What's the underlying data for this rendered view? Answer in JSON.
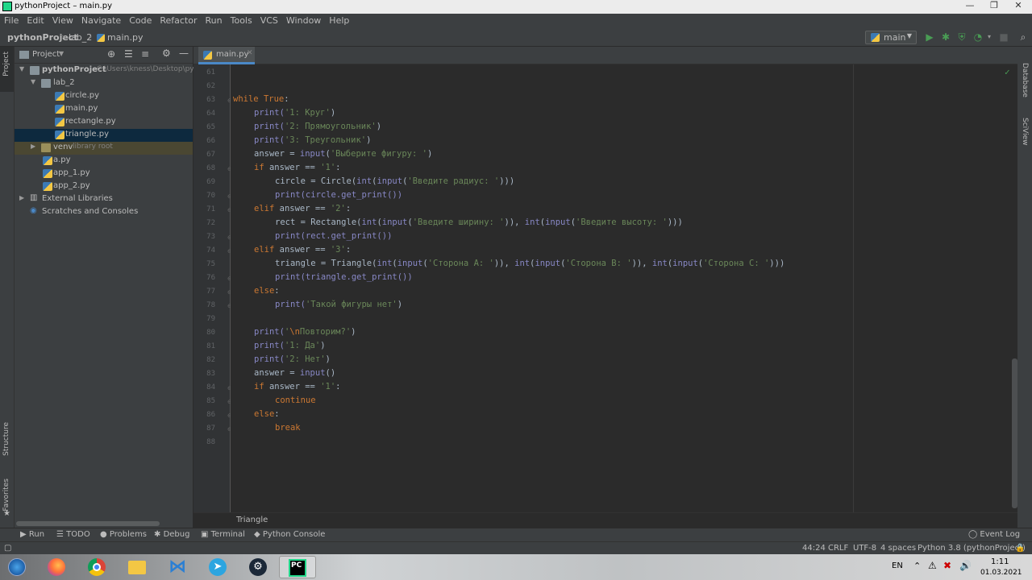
{
  "window": {
    "title": "pythonProject – main.py"
  },
  "menu": [
    "File",
    "Edit",
    "View",
    "Navigate",
    "Code",
    "Refactor",
    "Run",
    "Tools",
    "VCS",
    "Window",
    "Help"
  ],
  "breadcrumbs": [
    "pythonProject",
    "lab_2",
    "main.py"
  ],
  "run_config": "main",
  "left_tools": {
    "project": "Project",
    "structure": "Structure",
    "favorites": "Favorites"
  },
  "right_tools": {
    "database": "Database",
    "sciview": "SciView"
  },
  "project_panel": {
    "title": "Project",
    "root": {
      "name": "pythonProject",
      "path": "C:\\Users\\kness\\Desktop\\pyth"
    },
    "tree": [
      {
        "label": "lab_2"
      },
      {
        "label": "circle.py"
      },
      {
        "label": "main.py"
      },
      {
        "label": "rectangle.py"
      },
      {
        "label": "triangle.py"
      },
      {
        "label": "venv",
        "hint": "library root"
      },
      {
        "label": "a.py"
      },
      {
        "label": "app_1.py"
      },
      {
        "label": "app_2.py"
      },
      {
        "label": "External Libraries"
      },
      {
        "label": "Scratches and Consoles"
      }
    ]
  },
  "editor": {
    "tab": "main.py",
    "line_numbers": [
      "61",
      "62",
      "63",
      "64",
      "65",
      "66",
      "67",
      "68",
      "69",
      "70",
      "71",
      "72",
      "73",
      "74",
      "75",
      "76",
      "77",
      "78",
      "79",
      "80",
      "81",
      "82",
      "83",
      "84",
      "85",
      "86",
      "87",
      "88"
    ],
    "code": {
      "l63a": "while",
      "l63b": "True",
      "l64a": "print(",
      "l64b": "'1: Круг'",
      "l64c": ")",
      "l65a": "print(",
      "l65b": "'2: Прямоугольник'",
      "l65c": ")",
      "l66a": "print(",
      "l66b": "'3: Треугольник'",
      "l66c": ")",
      "l67a": "answer = ",
      "l67b": "input",
      "l67c": "(",
      "l67d": "'Выберите фигуру: '",
      "l67e": ")",
      "l68a": "if",
      "l68b": " answer == ",
      "l68c": "'1'",
      "l68d": ":",
      "l69a": "circle = Circle(",
      "l69b": "int",
      "l69c": "(",
      "l69d": "input",
      "l69e": "(",
      "l69f": "'Введите радиус: '",
      "l69g": ")))",
      "l70": "print(circle.get_print())",
      "l71a": "elif",
      "l71b": " answer == ",
      "l71c": "'2'",
      "l71d": ":",
      "l72a": "rect = Rectangle(",
      "l72b": "int",
      "l72c": "(",
      "l72d": "input",
      "l72e": "(",
      "l72f": "'Введите ширину: '",
      "l72g": ")), ",
      "l72h": "int",
      "l72i": "(",
      "l72j": "input",
      "l72k": "(",
      "l72l": "'Введите высоту: '",
      "l72m": ")))",
      "l73": "print(rect.get_print())",
      "l74a": "elif",
      "l74b": " answer == ",
      "l74c": "'3'",
      "l74d": ":",
      "l75a": "triangle = Triangle(",
      "l75b": "int",
      "l75c": "(",
      "l75d": "input",
      "l75e": "(",
      "l75f": "'Сторона А: '",
      "l75g": ")), ",
      "l75h": "int",
      "l75i": "(",
      "l75j": "input",
      "l75k": "(",
      "l75l": "'Сторона В: '",
      "l75m": ")), ",
      "l75n": "int",
      "l75o": "(",
      "l75p": "input",
      "l75q": "(",
      "l75r": "'Сторона С: '",
      "l75s": ")))",
      "l76": "print(triangle.get_print())",
      "l77": "else",
      "l77b": ":",
      "l78a": "print(",
      "l78b": "'Такой фигуры нет'",
      "l78c": ")",
      "l80a": "print(",
      "l80b": "'",
      "l80c": "\\n",
      "l80d": "Повторим?'",
      "l80e": ")",
      "l81a": "print(",
      "l81b": "'1: Да'",
      "l81c": ")",
      "l82a": "print(",
      "l82b": "'2: Нет'",
      "l82c": ")",
      "l83a": "answer = ",
      "l83b": "input",
      "l83c": "()",
      "l84a": "if",
      "l84b": " answer == ",
      "l84c": "'1'",
      "l84d": ":",
      "l85": "continue",
      "l86": "else",
      "l86b": ":",
      "l87": "break"
    },
    "breadcrumb": "Triangle"
  },
  "tool_windows": [
    "Run",
    "TODO",
    "Problems",
    "Debug",
    "Terminal",
    "Python Console"
  ],
  "event_log": "Event Log",
  "status": {
    "position": "44:24",
    "line_sep": "CRLF",
    "encoding": "UTF-8",
    "indent": "4 spaces",
    "interpreter": "Python 3.8 (pythonProject)"
  },
  "taskbar": {
    "lang": "EN",
    "time": "1:11",
    "date": "01.03.2021",
    "badge": "PC"
  },
  "colors": {
    "accent": "#4a88c7",
    "keyword": "#cc7832",
    "string": "#6a8759",
    "run_green": "#499c54"
  }
}
